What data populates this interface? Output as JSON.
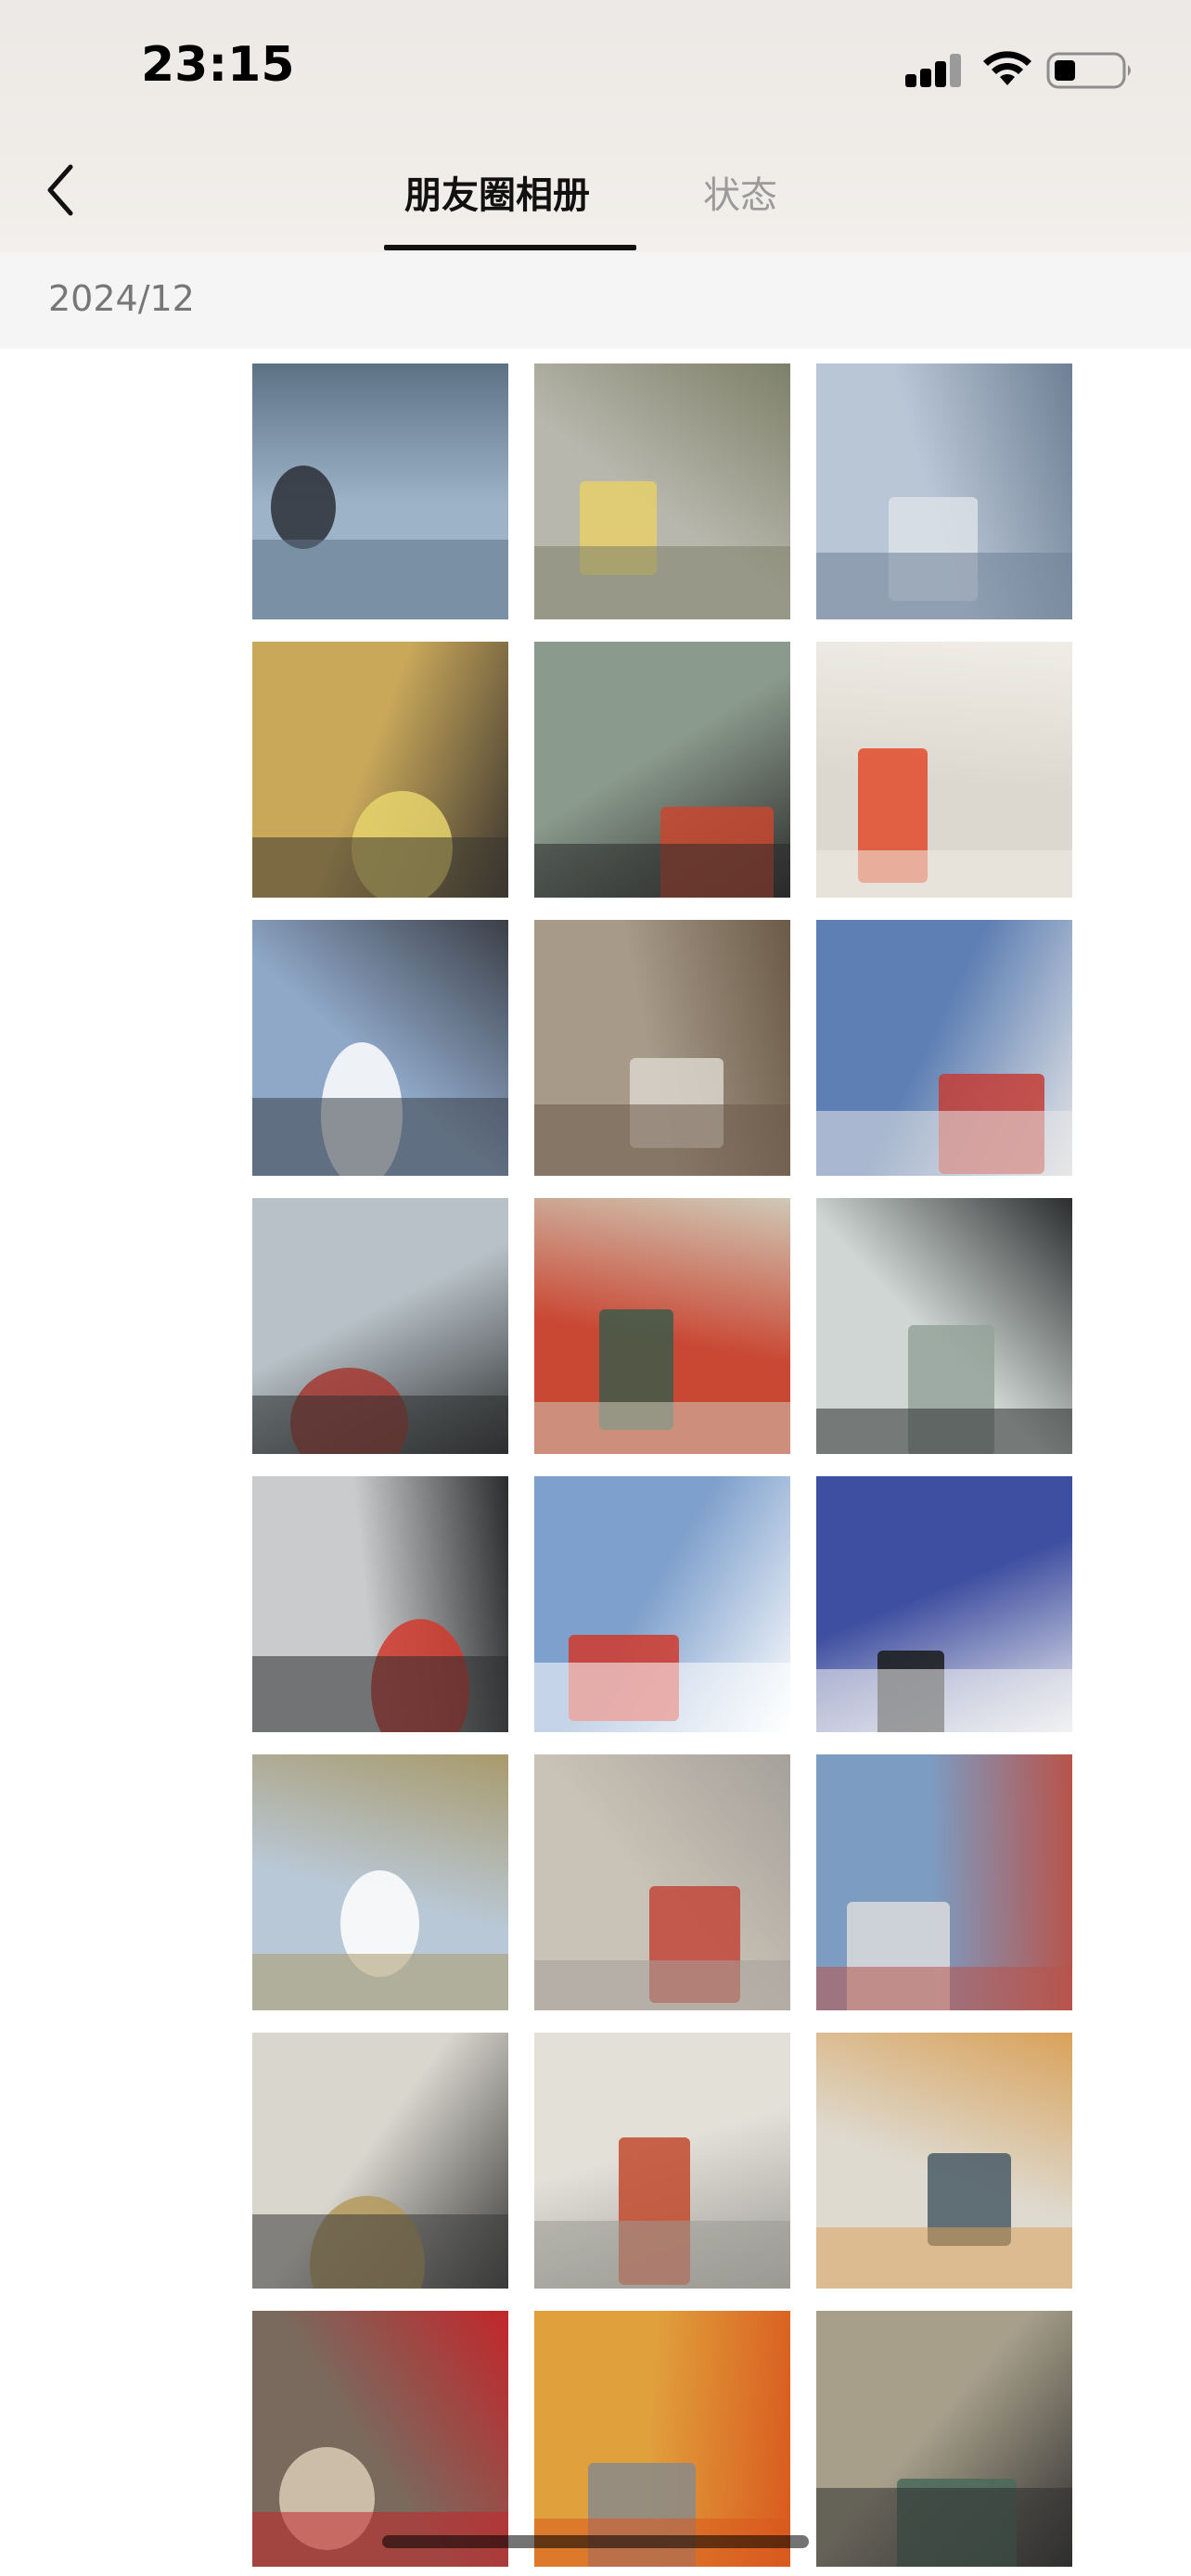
{
  "status_bar": {
    "time": "23:15",
    "icons": [
      "cellular-signal-icon",
      "wifi-icon",
      "battery-icon"
    ]
  },
  "nav": {
    "back_icon": "chevron-left-icon",
    "tabs": [
      {
        "label": "朋友圈相册",
        "active": true
      },
      {
        "label": "状态",
        "active": false
      }
    ]
  },
  "section": {
    "label": "2024/12"
  },
  "photos": [
    {
      "scene": "crew-on-deck-sea",
      "palette": [
        "#9cb3c8",
        "#5e7286",
        "#2b2f36"
      ]
    },
    {
      "scene": "engine-room-corridor",
      "palette": [
        "#b8b7ad",
        "#7d8069",
        "#e5d06a"
      ]
    },
    {
      "scene": "ship-crane-sky",
      "palette": [
        "#b9c6d6",
        "#6f7f95",
        "#dbe0e6"
      ]
    },
    {
      "scene": "engine-worker-yellow-pipes",
      "palette": [
        "#c9a85a",
        "#3b3630",
        "#e6d46c"
      ]
    },
    {
      "scene": "engine-repair-red-suit",
      "palette": [
        "#8a9a8c",
        "#2a2a2a",
        "#c8462f"
      ]
    },
    {
      "scene": "control-room-red-suit",
      "palette": [
        "#dcd8cf",
        "#f0ede6",
        "#e24a2a"
      ]
    },
    {
      "scene": "ship-superstructure-sky",
      "palette": [
        "#8fa8c8",
        "#3b3f47",
        "#ffffff"
      ]
    },
    {
      "scene": "cabin-refrigerator",
      "palette": [
        "#a79a88",
        "#6b5a48",
        "#d9d5cd"
      ]
    },
    {
      "scene": "ship-mast-blue-sky",
      "palette": [
        "#5d7fb3",
        "#e7e7e7",
        "#c43d36"
      ]
    },
    {
      "scene": "bridge-red-steering",
      "palette": [
        "#b7c1c7",
        "#2e2f30",
        "#a53a31"
      ]
    },
    {
      "scene": "lifeboat-top-view",
      "palette": [
        "#c94834",
        "#cfc9b6",
        "#3d5a4a"
      ]
    },
    {
      "scene": "bridge-console-windows",
      "palette": [
        "#cfd6d3",
        "#2b2d2e",
        "#94a39b"
      ]
    },
    {
      "scene": "lifebuoys-on-rail",
      "palette": [
        "#c9cbcc",
        "#2a2c2d",
        "#d13a2e"
      ]
    },
    {
      "scene": "lifeboat-funnel-sky",
      "palette": [
        "#7ea0cc",
        "#ffffff",
        "#d03a2c"
      ]
    },
    {
      "scene": "ship-name-sign-blue",
      "palette": [
        "#3e4ea0",
        "#f2f2f2",
        "#1a1a1a"
      ]
    },
    {
      "scene": "container-deck-sea",
      "palette": [
        "#b9c8d6",
        "#a89a6c",
        "#ffffff"
      ]
    },
    {
      "scene": "lifeboat-sea-clouds",
      "palette": [
        "#c9c2b6",
        "#a5a19a",
        "#c2473a"
      ]
    },
    {
      "scene": "crane-offshore-vessel",
      "palette": [
        "#7c9cc2",
        "#b8534a",
        "#dcdcdc"
      ]
    },
    {
      "scene": "control-panel-joystick",
      "palette": [
        "#d8d6cd",
        "#3a3a3a",
        "#b59a5a"
      ]
    },
    {
      "scene": "engine-control-room",
      "palette": [
        "#e3e0d8",
        "#9a9a94",
        "#c24a2e"
      ]
    },
    {
      "scene": "engine-control-clock",
      "palette": [
        "#dedad0",
        "#d9a25a",
        "#4a5a66"
      ]
    },
    {
      "scene": "boiler-red-door",
      "palette": [
        "#7a6a5e",
        "#c2262a",
        "#d9cbb5"
      ]
    },
    {
      "scene": "worker-orange-hull",
      "palette": [
        "#e0a03c",
        "#d95a1e",
        "#8a8a8a"
      ]
    },
    {
      "scene": "engine-cylinder-worker",
      "palette": [
        "#a79f8a",
        "#2f2f2f",
        "#4a6a5a"
      ]
    }
  ]
}
